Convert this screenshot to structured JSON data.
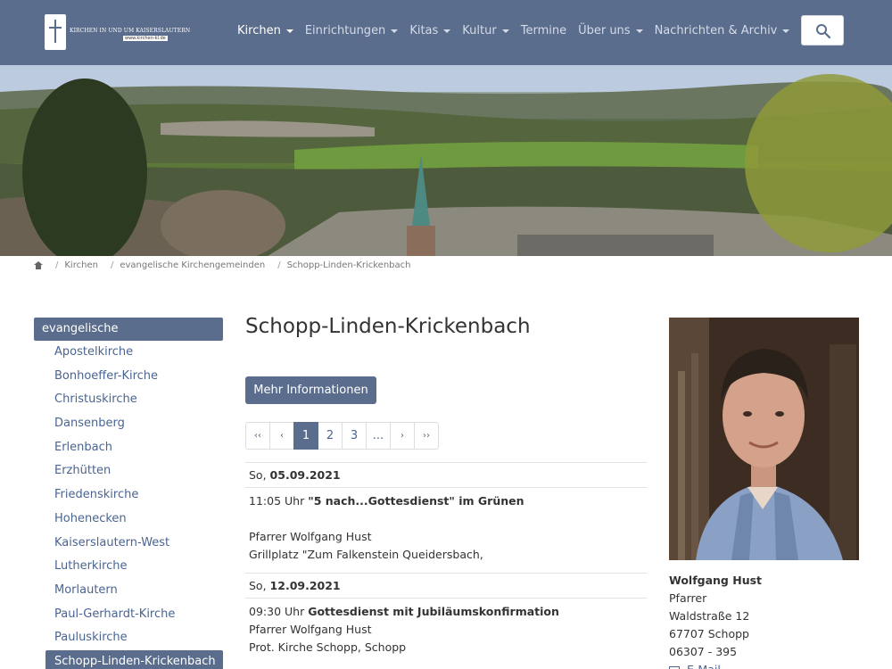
{
  "header": {
    "logo_text": "KIRCHEN IN UND UM KAISERSLAUTERN",
    "logo_url": "www.kirchen-kl.de",
    "nav": [
      {
        "label": "Kirchen",
        "dropdown": true,
        "active": true
      },
      {
        "label": "Einrichtungen",
        "dropdown": true
      },
      {
        "label": "Kitas",
        "dropdown": true
      },
      {
        "label": "Kultur",
        "dropdown": true
      },
      {
        "label": "Termine",
        "dropdown": false
      },
      {
        "label": "Über uns",
        "dropdown": true
      },
      {
        "label": "Nachrichten & Archiv",
        "dropdown": true
      }
    ],
    "search_icon": "search-icon"
  },
  "breadcrumb": [
    "Kirchen",
    "evangelische Kirchengemeinden",
    "Schopp-Linden-Krickenbach"
  ],
  "sidebar": {
    "heading": "evangelische Kirchengemeinden",
    "items": [
      {
        "label": "Apostelkirche"
      },
      {
        "label": "Bonhoeffer-Kirche"
      },
      {
        "label": "Christuskirche"
      },
      {
        "label": "Dansenberg"
      },
      {
        "label": "Erlenbach"
      },
      {
        "label": "Erzhütten"
      },
      {
        "label": "Friedenskirche"
      },
      {
        "label": "Hohenecken"
      },
      {
        "label": "Kaiserslautern-West"
      },
      {
        "label": "Lutherkirche"
      },
      {
        "label": "Morlautern"
      },
      {
        "label": "Paul-Gerhardt-Kirche"
      },
      {
        "label": "Pauluskirche"
      },
      {
        "label": "Schopp-Linden-Krickenbach",
        "active": true
      }
    ]
  },
  "main": {
    "title": "Schopp-Linden-Krickenbach",
    "more_button": "Mehr Informationen",
    "pagination": [
      "‹‹",
      "‹",
      "1",
      "2",
      "3",
      "...",
      "›",
      "››"
    ],
    "events": [
      {
        "day": "So,",
        "date": "05.09.2021",
        "time": "11:05 Uhr",
        "title": "\"5 nach...Gottesdienst\" im Grünen",
        "person": "Pfarrer Wolfgang Hust",
        "location": "Grillplatz \"Zum Falkenstein Queidersbach,"
      },
      {
        "day": "So,",
        "date": "12.09.2021",
        "time": "09:30 Uhr",
        "title": "Gottesdienst mit Jubiläumskonfirmation",
        "person": "Pfarrer Wolfgang Hust",
        "location": "Prot. Kirche Schopp, Schopp"
      }
    ]
  },
  "contact": {
    "name": "Wolfgang Hust",
    "role": "Pfarrer",
    "street": "Waldstraße 12",
    "city": "67707 Schopp",
    "phone": "06307 - 395",
    "email_label": "E-Mail"
  },
  "colors": {
    "header_bg": "#5b6d8c",
    "link": "#4a6491",
    "active_bg": "#5b6d8c"
  }
}
